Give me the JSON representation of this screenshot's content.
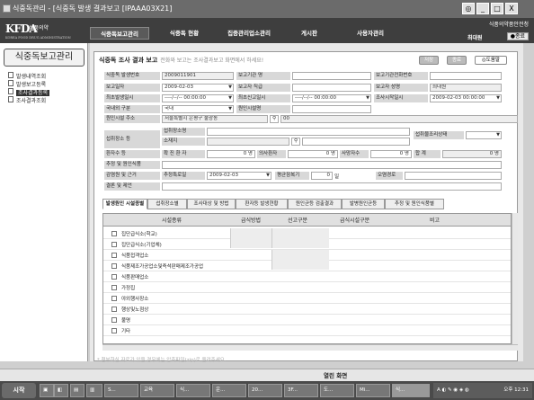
{
  "window": {
    "title": "식중독관리 - [식중독 발생 결과보고 [IPAAA03X21]",
    "minimize": "_",
    "restore": "□",
    "close": "X",
    "extra": "◎"
  },
  "logo": {
    "mark": "KFDA",
    "name": "식품의약",
    "subtitle": "KOREA FOOD DRUG ADMINISTRATION"
  },
  "nav": [
    "식중독보고관리",
    "식중독 현황",
    "집중관리업소관리",
    "게시판",
    "사용자관리"
  ],
  "user": {
    "org": "식품의약품안전청",
    "name": "최대원",
    "logout": "●종료"
  },
  "sidebar": {
    "title": "식중독보고관리",
    "items": [
      "발생내역조회",
      "발생보고등록",
      "조사결과등록",
      "조사결과조회"
    ]
  },
  "panel": {
    "title": "식중독 조사 결과 보고",
    "hint": "전화와 보고는 조사결과보고 화면에서 하세요!",
    "buttons": [
      "저장",
      "종료",
      "◎도움말"
    ]
  },
  "form": {
    "labels": [
      "식중독 발생번호",
      "보고일자",
      "최초발생일시",
      "국내외 구분",
      "원인시설 주소",
      "섭취장소 등",
      "환자수 등",
      "추정 및 원인식품",
      "감염원 및 근거",
      "결론 및 제언",
      "보고기관 명",
      "보고자 직급",
      "최초신고일시",
      "원인시설명",
      "섭취장소명",
      "소재지",
      "확 진 환 자",
      "의사환자",
      "사망자수",
      "합  계",
      "추정특로일",
      "평균잠복기",
      "오염경로",
      "보고기관전화번호",
      "보고자 성명",
      "조사시작일시",
      "섭취물조리상태"
    ],
    "values": {
      "case_no": "2009011901",
      "report_date": "2009-02-03",
      "first_date": "----/--/-- 00:00:00",
      "domestic": "국내",
      "address": "서울특별시 은평구 불광동",
      "addr2": "00",
      "first_report": "----/--/-- 00:00:00",
      "reporter": "최대원",
      "start_date": "2009-02-03 00:00:00",
      "confirmed": "0 명",
      "suspected": "0 명",
      "deaths": "0 명",
      "total": "0 명",
      "est_date": "2009-02-03",
      "incubation": "0",
      "incub_unit": "일"
    }
  },
  "tabs": [
    "발생원인 시설종별",
    "섭취장소별",
    "조사대상 및 방법",
    "환자등 발생현황",
    "원인균등 검출결과",
    "발병원인균등",
    "추정 및 원인식품별"
  ],
  "grid": {
    "headers": [
      "시설종류",
      "급식방법",
      "선고구분",
      "급식시설구분",
      "비고"
    ],
    "rows": [
      "집단급식소(학교)",
      "집단급식소(기업체)",
      "식품접객업소",
      "식품제조가공업소및즉석판매제조가공업",
      "식품판매업소",
      "가정집",
      "야외행사장소",
      "행상및노점상",
      "불명",
      "기타"
    ]
  },
  "footnote": "* 첨부하실 자료가 있을 경우에는 압축파일(zip)로 올려주세요.",
  "statusbar": {
    "text": "열린 화면"
  },
  "taskbar": {
    "start": "시작",
    "tasks": [
      "S...",
      "교육",
      "식...",
      "운...",
      "20...",
      "3F...",
      "도...",
      "Mi...",
      "식..."
    ],
    "clock": "오후 12:31"
  }
}
